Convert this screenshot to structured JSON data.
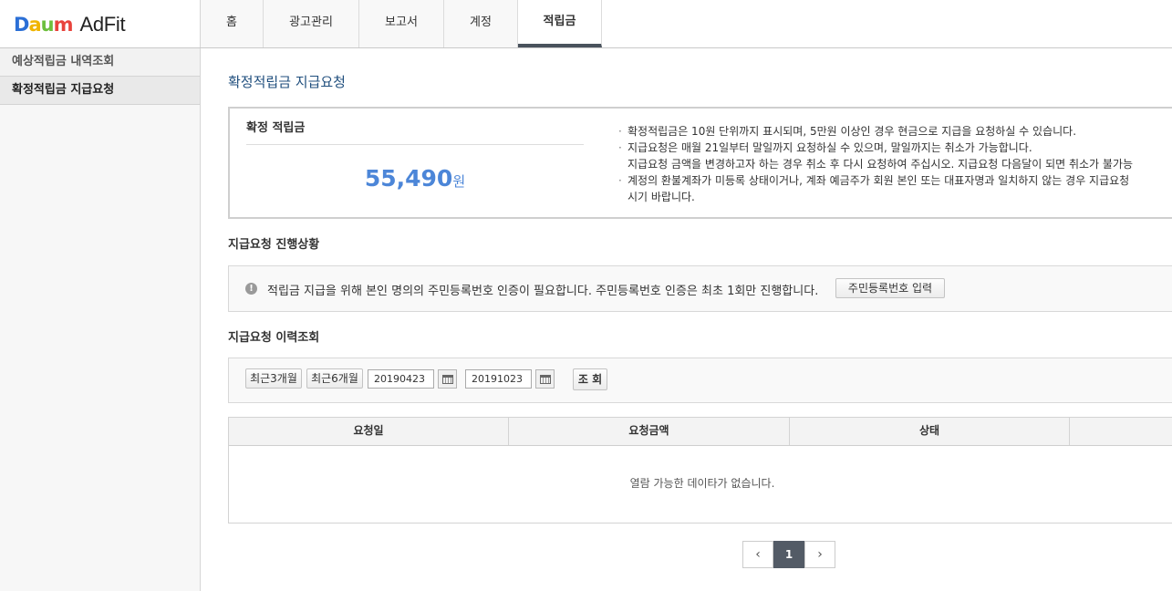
{
  "logo": {
    "daum_letters": [
      "D",
      "a",
      "u",
      "m"
    ],
    "product": "AdFit"
  },
  "gnb": [
    {
      "label": "홈",
      "width": 69,
      "active": false
    },
    {
      "label": "광고관리",
      "width": 105,
      "active": false
    },
    {
      "label": "보고서",
      "width": 93,
      "active": false
    },
    {
      "label": "계정",
      "width": 81,
      "active": false
    },
    {
      "label": "적립금",
      "width": 92,
      "active": true
    }
  ],
  "sidebar": {
    "items": [
      {
        "label": "예상적립금 내역조회",
        "active": false
      },
      {
        "label": "확정적립금 지급요청",
        "active": true
      }
    ]
  },
  "page": {
    "title": "확정적립금 지급요청"
  },
  "summary": {
    "label": "확정 적립금",
    "amount": "55,490",
    "unit": "원",
    "notes": [
      "확정적립금은 10원 단위까지 표시되며, 5만원 이상인 경우 현금으로 지급을 요청하실 수 있습니다.",
      "지급요청은 매월 21일부터 말일까지 요청하실 수 있으며, 말일까지는 취소가 가능합니다.",
      "지급요청 금액을 변경하고자 하는 경우 취소 후 다시 요청하여 주십시오. 지급요청 다음달이 되면 취소가 불가능",
      "계정의 환불계좌가 미등록 상태이거나, 계좌 예금주가 회원 본인 또는 대표자명과 일치하지 않는 경우 지급요청",
      "시기 바랍니다."
    ]
  },
  "progress": {
    "title": "지급요청 진행상황",
    "notice": "적립금 지급을 위해 본인 명의의 주민등록번호 인증이 필요합니다. 주민등록번호 인증은 최초 1회만 진행합니다.",
    "button": "주민등록번호 입력"
  },
  "history": {
    "title": "지급요청 이력조회",
    "btn_3m": "최근3개월",
    "btn_6m": "최근6개월",
    "start_date": "20190423",
    "end_date": "20191023",
    "search": "조 회",
    "columns": [
      "요청일",
      "요청금액",
      "상태"
    ],
    "empty": "열람 가능한 데이타가 없습니다."
  },
  "pager": {
    "prev": "‹",
    "current": "1",
    "next": "›"
  },
  "colors": {
    "title": "#1f4e7d",
    "amount": "#4c86d8",
    "pager_active": "#535b66"
  }
}
